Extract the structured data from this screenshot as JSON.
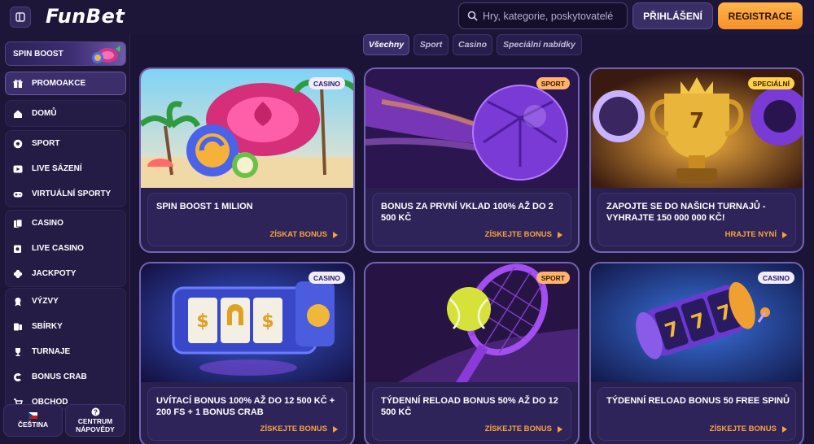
{
  "header": {
    "logo": "FunBet",
    "search_placeholder": "Hry, kategorie, poskytovatelé",
    "login_label": "PŘIHLÁŠENÍ",
    "register_label": "REGISTRACE"
  },
  "sidebar": {
    "spin_boost": "SPIN BOOST",
    "promo": "PROMOAKCE",
    "group1": [
      {
        "label": "DOMŮ",
        "icon": "home-icon"
      }
    ],
    "group2": [
      {
        "label": "SPORT",
        "icon": "soccer-ball-icon"
      },
      {
        "label": "LIVE SÁZENÍ",
        "icon": "live-play-icon"
      },
      {
        "label": "VIRTUÁLNÍ SPORTY",
        "icon": "gamepad-icon"
      }
    ],
    "group3": [
      {
        "label": "CASINO",
        "icon": "casino-cards-icon"
      },
      {
        "label": "LIVE CASINO",
        "icon": "live-casino-icon"
      },
      {
        "label": "JACKPOTY",
        "icon": "clover-icon"
      }
    ],
    "group4": [
      {
        "label": "VÝZVY",
        "icon": "medal-icon"
      },
      {
        "label": "SBÍRKY",
        "icon": "collection-icon"
      },
      {
        "label": "TURNAJE",
        "icon": "trophy-icon"
      },
      {
        "label": "BONUS CRAB",
        "icon": "crab-icon"
      },
      {
        "label": "OBCHOD",
        "icon": "shop-icon"
      }
    ],
    "language": "ČEŠTINA",
    "help_line1": "CENTRUM",
    "help_line2": "NÁPOVĚDY"
  },
  "tabs": [
    "Všechny",
    "Sport",
    "Casino",
    "Speciální nabídky"
  ],
  "cards": [
    {
      "badge": "CASINO",
      "title": "SPIN BOOST 1 MILION",
      "cta": "ZÍSKAT BONUS"
    },
    {
      "badge": "SPORT",
      "title": "BONUS ZA PRVNÍ VKLAD 100% AŽ DO 2 500 KČ",
      "cta": "ZÍSKEJTE BONUS"
    },
    {
      "badge": "SPECIÁLNÍ",
      "title": "ZAPOJTE SE DO NAŠICH TURNAJŮ - VYHRAJTE 150 000 000 KČ!",
      "cta": "HRAJTE NYNÍ"
    },
    {
      "badge": "CASINO",
      "title": "UVÍTACÍ BONUS 100% AŽ DO 12 500 KČ + 200 FS + 1 BONUS CRAB",
      "cta": "ZÍSKEJTE BONUS"
    },
    {
      "badge": "SPORT",
      "title": "TÝDENNÍ RELOAD BONUS 50% AŽ DO 12 500 KČ",
      "cta": "ZÍSKEJTE BONUS"
    },
    {
      "badge": "CASINO",
      "title": "TÝDENNÍ RELOAD BONUS 50 FREE SPINŮ",
      "cta": "ZÍSKEJTE BONUS"
    }
  ],
  "colors": {
    "accent": "#f7a43a",
    "bg": "#1c1436",
    "card_border": "#7462b3"
  }
}
